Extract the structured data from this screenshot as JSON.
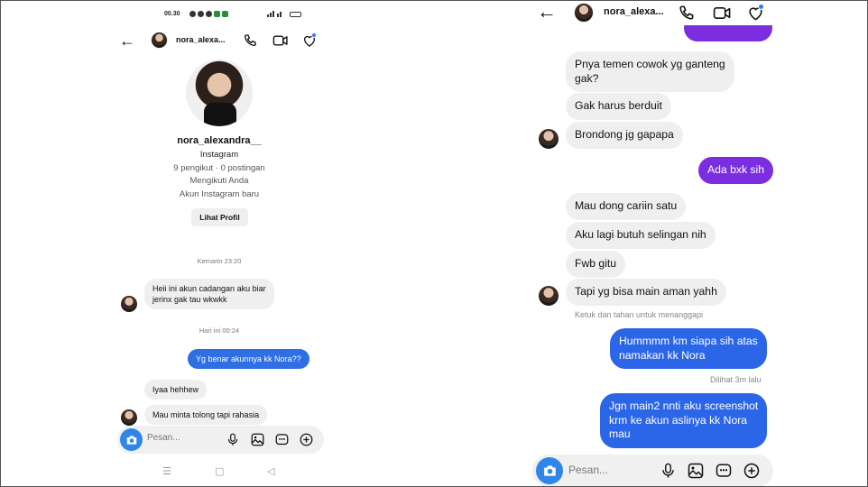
{
  "left": {
    "status": {
      "time": "00.30"
    },
    "header": {
      "username": "nora_alexa..."
    },
    "profile": {
      "name": "nora_alexandra__",
      "platform": "Instagram",
      "stats": "9 pengikut · 0 postingan",
      "follow_status": "Mengikuti Anda",
      "account_note": "Akun Instagram baru",
      "view_profile_label": "Lihat Profil"
    },
    "timestamps": [
      "Kemarin 23:20",
      "Hari ini 00:24"
    ],
    "messages": [
      {
        "from": "them",
        "lines": [
          "Heii ini akun cadangan aku biar",
          "jerinx gak tau wkwkk"
        ]
      },
      {
        "from": "me",
        "lines": [
          "Yg benar akunnya kk Nora??"
        ]
      },
      {
        "from": "them",
        "lines": [
          "Iyaa hehhew"
        ]
      },
      {
        "from": "them",
        "lines": [
          "Mau minta tolong tapi rahasia"
        ]
      }
    ],
    "composer": {
      "placeholder": "Pesan..."
    }
  },
  "right": {
    "header": {
      "username": "nora_alexa..."
    },
    "messages": [
      {
        "from": "them",
        "lines": [
          "Pnya temen cowok yg ganteng",
          "gak?"
        ]
      },
      {
        "from": "them",
        "lines": [
          "Gak harus berduit"
        ]
      },
      {
        "from": "them",
        "lines": [
          "Brondong jg gapapa"
        ]
      },
      {
        "from": "me",
        "lines": [
          "Ada bxk sih"
        ]
      },
      {
        "from": "them",
        "lines": [
          "Mau dong cariin satu"
        ]
      },
      {
        "from": "them",
        "lines": [
          "Aku lagi butuh selingan nih"
        ]
      },
      {
        "from": "them",
        "lines": [
          "Fwb gitu"
        ]
      },
      {
        "from": "them",
        "lines": [
          "Tapi yg bisa main aman yahh"
        ]
      },
      {
        "from": "me",
        "lines": [
          "Hummmm km siapa sih atas",
          "namakan kk Nora"
        ]
      },
      {
        "from": "me",
        "lines": [
          "Jgn main2 nnti aku screenshot",
          "krm ke akun aslinya kk Nora",
          "mau"
        ]
      }
    ],
    "reply_hint": "Ketuk dan tahan untuk menanggapi",
    "seen_status": "Dilihat 3m lalu",
    "composer": {
      "placeholder": "Pesan..."
    }
  },
  "colors": {
    "outgoing_blue": "#2f6fe4",
    "outgoing_purple": "#7b2ee0",
    "incoming_gray": "#efefef",
    "camera_blue": "#2f86e8",
    "unread_dot": "#2f7bf6"
  },
  "icons": [
    "back-arrow-icon",
    "phone-icon",
    "video-icon",
    "heart-shield-icon",
    "camera-icon",
    "mic-icon",
    "gallery-icon",
    "sticker-icon",
    "add-icon",
    "nav-menu-icon",
    "nav-home-icon",
    "nav-back-icon"
  ]
}
